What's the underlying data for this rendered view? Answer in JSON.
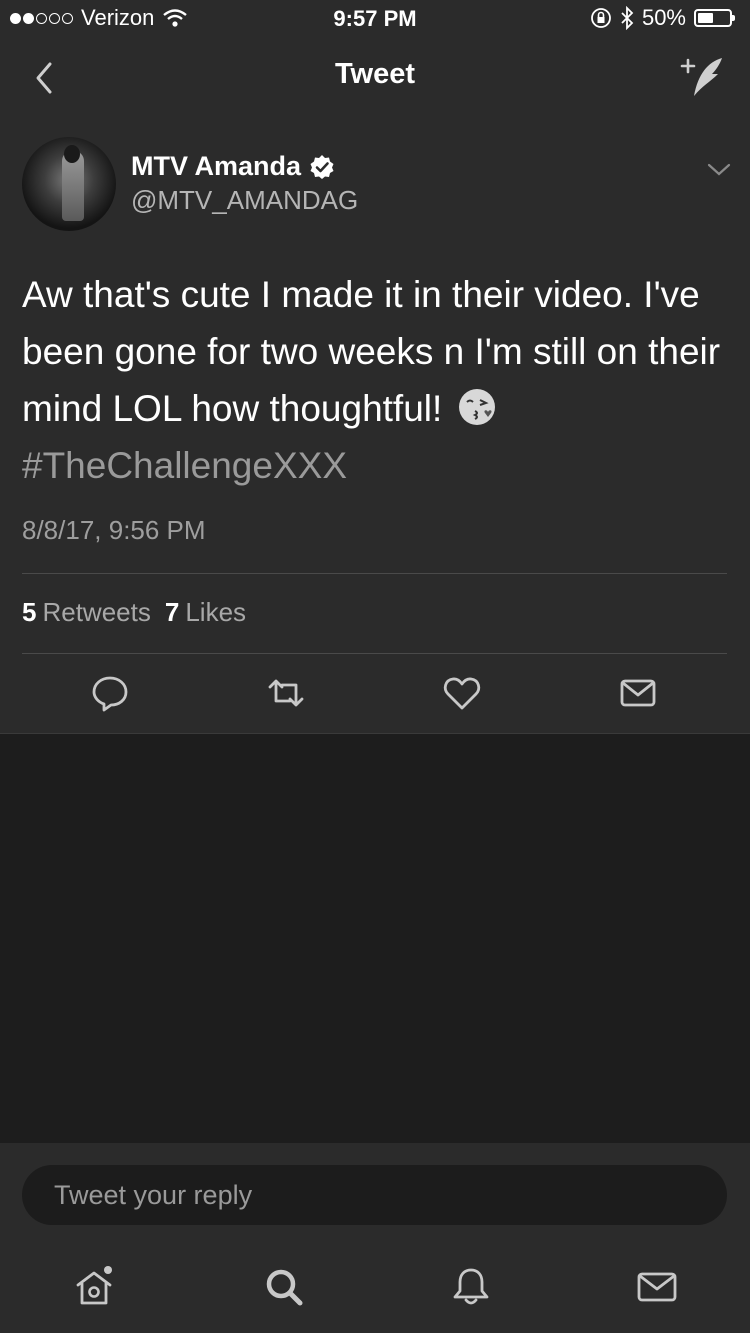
{
  "status_bar": {
    "carrier": "Verizon",
    "time": "9:57 PM",
    "battery": "50%",
    "battery_level": 0.5
  },
  "nav": {
    "title": "Tweet"
  },
  "tweet": {
    "author_name": "MTV Amanda",
    "handle": "@MTV_AMANDAG",
    "text": "Aw that's cute I made it in their video. I've been gone for two weeks n I'm still on their mind LOL how thoughtful!",
    "emoji": "😘",
    "hashtag": "#TheChallengeXXX",
    "timestamp": "8/8/17, 9:56 PM",
    "retweets_count": "5",
    "retweets_label": "Retweets",
    "likes_count": "7",
    "likes_label": "Likes"
  },
  "reply": {
    "placeholder": "Tweet your reply"
  },
  "icons": {
    "back": "chevron-left-icon",
    "compose": "compose-tweet-icon",
    "verified": "verified-badge-icon",
    "more": "chevron-down-icon",
    "reply": "reply-icon",
    "retweet": "retweet-icon",
    "like": "heart-icon",
    "dm": "envelope-icon",
    "home": "home-icon",
    "search": "search-icon",
    "notifications": "bell-icon",
    "messages": "envelope-icon"
  },
  "colors": {
    "background": "#1d1d1d",
    "card": "#2b2b2b",
    "text": "#ffffff",
    "muted": "#9e9e9e"
  }
}
